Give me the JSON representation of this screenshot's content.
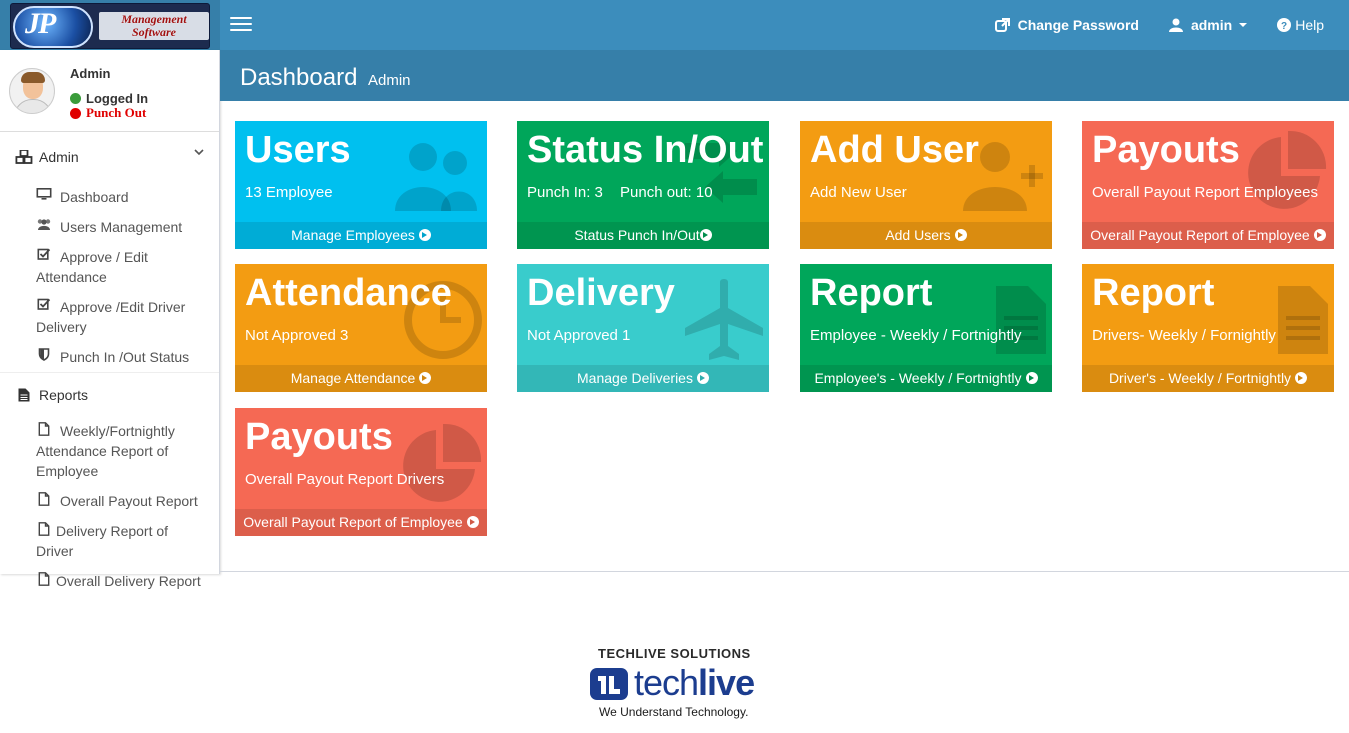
{
  "header": {
    "logo_letters": "JP",
    "logo_text_line1": "Management",
    "logo_text_line2": "Software",
    "change_password": "Change Password",
    "user_menu": "admin",
    "help": "Help"
  },
  "sidebar": {
    "user_name": "Admin",
    "status": "Logged In",
    "punch": "Punch Out",
    "sections": [
      {
        "label": "Admin"
      },
      {
        "label": "Reports"
      }
    ],
    "admin_items": [
      {
        "label": "Dashboard"
      },
      {
        "label": "Users Management"
      },
      {
        "label": "Approve / Edit",
        "label2": "Attendance"
      },
      {
        "label": "Approve /Edit Driver",
        "label2": "Delivery"
      },
      {
        "label": "Punch In /Out Status"
      }
    ],
    "report_items": [
      {
        "label": "Weekly/Fortnightly",
        "label2": "Attendance Report of",
        "label3": "Employee"
      },
      {
        "label": "Overall Payout Report"
      },
      {
        "label": "Delivery Report of Driver"
      },
      {
        "label": "Overall Delivery Report"
      }
    ]
  },
  "page": {
    "title": "Dashboard",
    "subtitle": "Admin"
  },
  "tiles": [
    {
      "title": "Users",
      "sub": "13 Employee",
      "footer": "Manage Employees",
      "color": "#00c0ef",
      "icon": "users-icon"
    },
    {
      "title": "Status In/Out",
      "sub": "Punch In: 3",
      "sub2": "Punch out: 10",
      "footer": "Status Punch In/Out",
      "color": "#00a65a",
      "icon": "exchange-icon"
    },
    {
      "title": "Add User",
      "sub": "Add New User",
      "footer": "Add Users",
      "color": "#f39c12",
      "icon": "user-plus-icon"
    },
    {
      "title": "Payouts",
      "sub": "Overall Payout Report Employees",
      "footer": "Overall Payout Report of Employee",
      "color": "#f56954",
      "icon": "pie-chart-icon"
    },
    {
      "title": "Attendance",
      "sub": "Not Approved 3",
      "footer": "Manage Attendance",
      "color": "#f39c12",
      "icon": "clock-icon"
    },
    {
      "title": "Delivery",
      "sub": "Not Approved 1",
      "footer": "Manage Deliveries",
      "color": "#39cccc",
      "icon": "plane-icon"
    },
    {
      "title": "Report",
      "sub": "Employee - Weekly / Fortnightly",
      "footer": "Employee's - Weekly / Fortnightly",
      "color": "#00a65a",
      "icon": "document-icon"
    },
    {
      "title": "Report",
      "sub": "Drivers- Weekly / Fornightly",
      "footer": "Driver's - Weekly / Fortnightly",
      "color": "#f39c12",
      "icon": "document-icon"
    },
    {
      "title": "Payouts",
      "sub": "Overall Payout Report Drivers",
      "footer": "Overall Payout Report of Employee",
      "color": "#f56954",
      "icon": "pie-chart-icon"
    }
  ],
  "footer": {
    "company": "TECHLIVE SOLUTIONS",
    "brand_light": "tech",
    "brand_bold": "live",
    "tagline": "We Understand Technology."
  }
}
